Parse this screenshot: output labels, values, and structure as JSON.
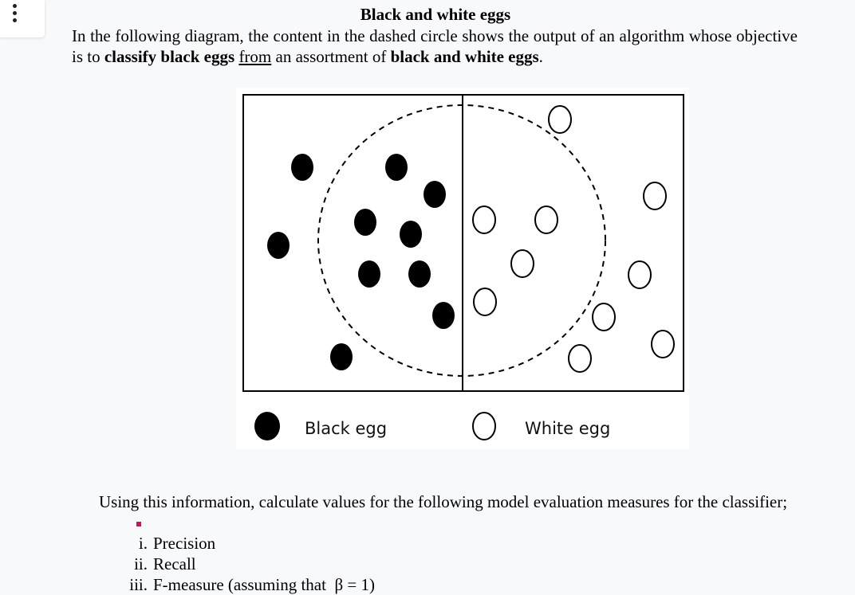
{
  "toolbar": {
    "menu_icon": "more-vertical-icon"
  },
  "document": {
    "title": "Black and white eggs",
    "intro": {
      "part1": "In the following diagram, the content in the dashed circle shows the output of an algorithm whose objective is to ",
      "bold1": "classify black eggs",
      "space1": " ",
      "underlined": "from",
      "part2": " an assortment of ",
      "bold2": "black and white eggs",
      "end": "."
    },
    "question": "Using this information, calculate values for the following model evaluation measures for the classifier;",
    "measures": [
      {
        "num": "i.",
        "text": "Precision"
      },
      {
        "num": "ii.",
        "text": "Recall"
      },
      {
        "num": "iii.",
        "text": "F-measure (assuming that  β = 1)"
      }
    ]
  },
  "diagram": {
    "legend": {
      "black_label": "Black egg",
      "white_label": "White egg"
    },
    "colors": {
      "black_egg": "#000000",
      "white_egg_fill": "#ffffff",
      "white_egg_stroke": "#000000",
      "frame": "#000000"
    }
  }
}
